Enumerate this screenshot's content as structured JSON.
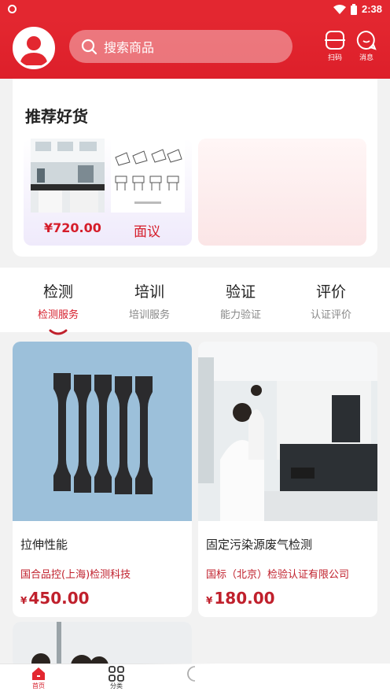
{
  "statusbar": {
    "time": "2:38"
  },
  "header": {
    "search_placeholder": "搜索商品",
    "scan_label": "扫码",
    "message_label": "消息"
  },
  "recommend": {
    "title": "推荐好货",
    "items": [
      {
        "price": "¥720.00"
      },
      {
        "price": "面议"
      }
    ]
  },
  "tabs": [
    {
      "title": "检测",
      "subtitle": "检测服务"
    },
    {
      "title": "培训",
      "subtitle": "培训服务"
    },
    {
      "title": "验证",
      "subtitle": "能力验证"
    },
    {
      "title": "评价",
      "subtitle": "认证评价"
    }
  ],
  "products": [
    {
      "name": "拉伸性能",
      "company": "国合品控(上海)检测科技",
      "currency": "¥",
      "price": "450.00"
    },
    {
      "name": "固定污染源废气检测",
      "company": "国标（北京）检验认证有限公司",
      "currency": "¥",
      "price": "180.00"
    }
  ],
  "nav": {
    "home": "首页",
    "category": "分类"
  },
  "colors": {
    "brand": "#e32730",
    "price": "#c0202c"
  }
}
